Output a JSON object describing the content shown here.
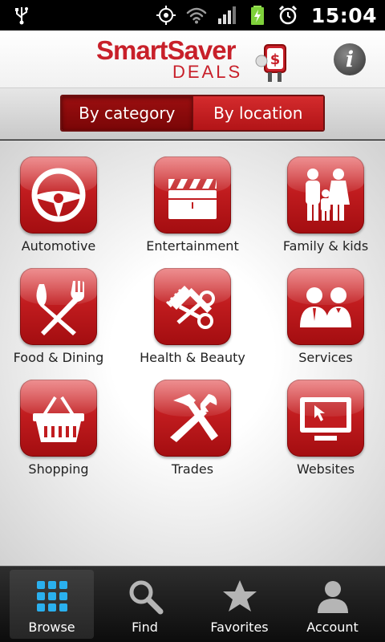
{
  "status_bar": {
    "time": "15:04"
  },
  "header": {
    "logo_smart": "Smart",
    "logo_saver": "Saver",
    "logo_deals": "DEALS",
    "info_label": "i"
  },
  "segmented": {
    "by_category": "By category",
    "by_location": "By location",
    "selected": "By category"
  },
  "categories": [
    {
      "label": "Automotive",
      "icon": "steering-wheel-icon"
    },
    {
      "label": "Entertainment",
      "icon": "clapperboard-icon"
    },
    {
      "label": "Family & kids",
      "icon": "family-icon"
    },
    {
      "label": "Food & Dining",
      "icon": "fork-knife-icon"
    },
    {
      "label": "Health & Beauty",
      "icon": "comb-scissors-icon"
    },
    {
      "label": "Services",
      "icon": "people-icon"
    },
    {
      "label": "Shopping",
      "icon": "basket-icon"
    },
    {
      "label": "Trades",
      "icon": "hammer-wrench-icon"
    },
    {
      "label": "Websites",
      "icon": "monitor-cursor-icon"
    }
  ],
  "bottom_nav": [
    {
      "label": "Browse",
      "icon": "grid-icon",
      "active": true
    },
    {
      "label": "Find",
      "icon": "magnifier-icon",
      "active": false
    },
    {
      "label": "Favorites",
      "icon": "star-icon",
      "active": false
    },
    {
      "label": "Account",
      "icon": "person-icon",
      "active": false
    }
  ],
  "colors": {
    "brand_red": "#c8202a",
    "tile_red": "#c11c1f",
    "segment_selected": "#8a0a0b",
    "browse_blue": "#2ab0ee"
  }
}
